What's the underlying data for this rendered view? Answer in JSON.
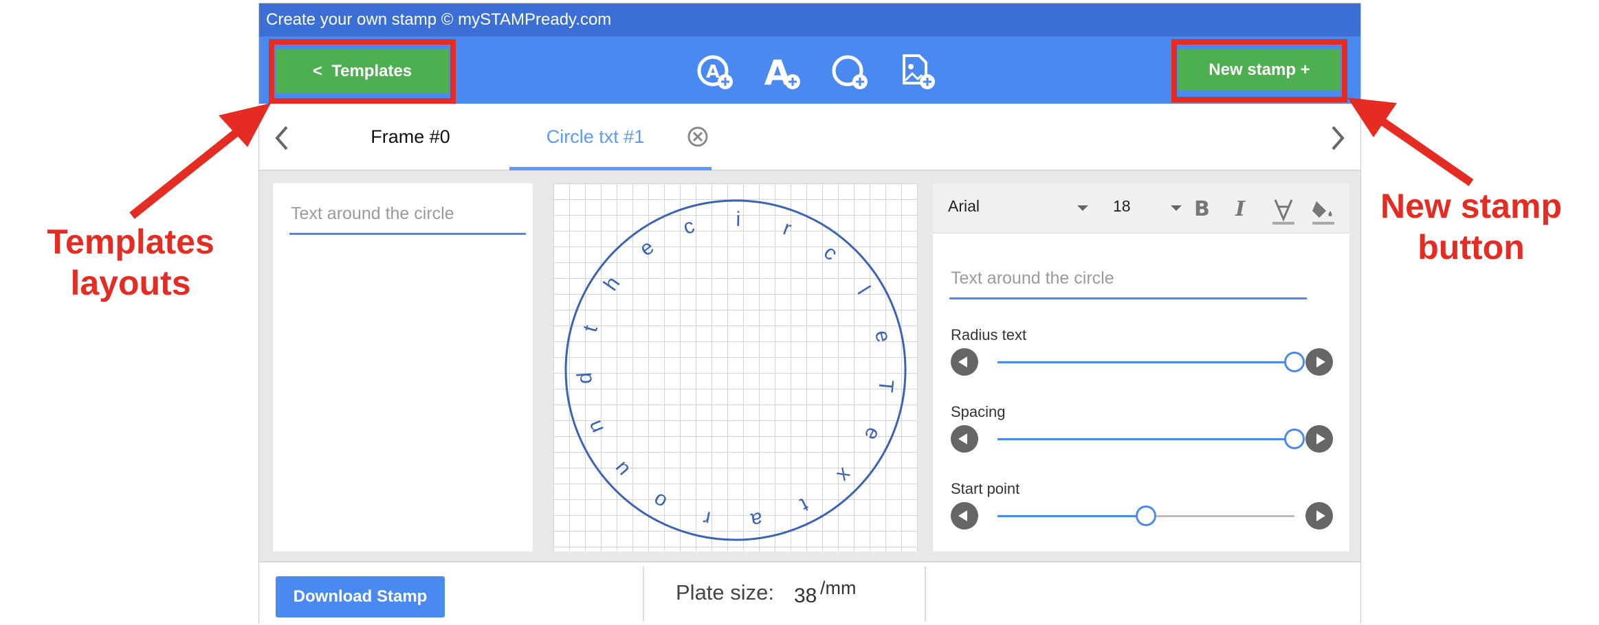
{
  "app": {
    "title": "Create your own stamp © mySTAMPready.com"
  },
  "toolbar": {
    "templates_label": "<  Templates",
    "new_stamp_label": "New stamp +",
    "tools": [
      "add-circle-text-icon",
      "add-text-icon",
      "add-circle-icon",
      "add-image-icon"
    ]
  },
  "tabs": {
    "frame": "Frame #0",
    "circle": "Circle txt #1"
  },
  "left_panel": {
    "placeholder": "Text around the circle"
  },
  "canvas": {
    "circle_text": "circleTextaroundthe"
  },
  "right_panel": {
    "font": "Arial",
    "font_size": "18",
    "text_placeholder": "Text around the circle",
    "sliders": [
      {
        "label": "Radius text",
        "value": 1.0
      },
      {
        "label": "Spacing",
        "value": 1.0
      },
      {
        "label": "Start point",
        "value": 0.5
      }
    ]
  },
  "bottom": {
    "download_label": "Download Stamp",
    "plate_label": "Plate size:",
    "plate_value": "38",
    "plate_unit": "/mm"
  },
  "annotations": {
    "templates": "Templates\nlayouts",
    "new_stamp": "New stamp\nbutton"
  },
  "colors": {
    "primary": "#4a8af0",
    "titlebar": "#3b6fd6",
    "green": "#4caf50",
    "annotation": "#e52b22",
    "circle": "#3a63b8"
  }
}
